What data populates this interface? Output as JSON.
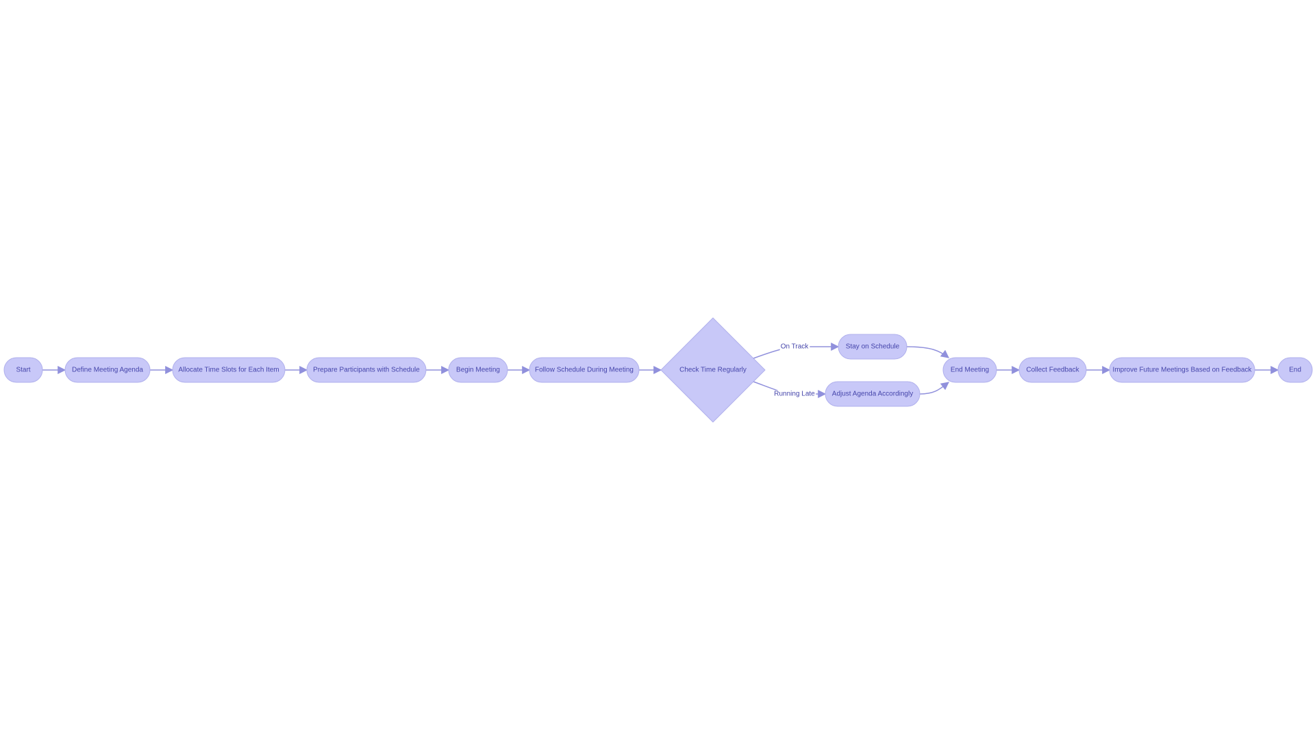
{
  "diagram": {
    "type": "flowchart",
    "direction": "left-to-right",
    "colors": {
      "node_fill": "#c8c8f8",
      "node_stroke": "#b0b0ec",
      "text": "#4444aa",
      "edge": "#9090dc",
      "background": "#ffffff"
    },
    "nodes": [
      {
        "id": "start",
        "label": "Start",
        "shape": "stadium"
      },
      {
        "id": "define",
        "label": "Define Meeting Agenda",
        "shape": "stadium"
      },
      {
        "id": "allocate",
        "label": "Allocate Time Slots for Each Item",
        "shape": "stadium"
      },
      {
        "id": "prepare",
        "label": "Prepare Participants with Schedule",
        "shape": "stadium"
      },
      {
        "id": "begin",
        "label": "Begin Meeting",
        "shape": "stadium"
      },
      {
        "id": "follow",
        "label": "Follow Schedule During Meeting",
        "shape": "stadium"
      },
      {
        "id": "check",
        "label": "Check Time Regularly",
        "shape": "diamond"
      },
      {
        "id": "stay",
        "label": "Stay on Schedule",
        "shape": "stadium"
      },
      {
        "id": "adjust",
        "label": "Adjust Agenda Accordingly",
        "shape": "stadium"
      },
      {
        "id": "endmeeting",
        "label": "End Meeting",
        "shape": "stadium"
      },
      {
        "id": "collect",
        "label": "Collect Feedback",
        "shape": "stadium"
      },
      {
        "id": "improve",
        "label": "Improve Future Meetings Based on Feedback",
        "shape": "stadium"
      },
      {
        "id": "end",
        "label": "End",
        "shape": "stadium"
      }
    ],
    "edges": [
      {
        "from": "start",
        "to": "define",
        "label": ""
      },
      {
        "from": "define",
        "to": "allocate",
        "label": ""
      },
      {
        "from": "allocate",
        "to": "prepare",
        "label": ""
      },
      {
        "from": "prepare",
        "to": "begin",
        "label": ""
      },
      {
        "from": "begin",
        "to": "follow",
        "label": ""
      },
      {
        "from": "follow",
        "to": "check",
        "label": ""
      },
      {
        "from": "check",
        "to": "stay",
        "label": "On Track"
      },
      {
        "from": "check",
        "to": "adjust",
        "label": "Running Late"
      },
      {
        "from": "stay",
        "to": "endmeeting",
        "label": ""
      },
      {
        "from": "adjust",
        "to": "endmeeting",
        "label": ""
      },
      {
        "from": "endmeeting",
        "to": "collect",
        "label": ""
      },
      {
        "from": "collect",
        "to": "improve",
        "label": ""
      },
      {
        "from": "improve",
        "to": "end",
        "label": ""
      }
    ]
  }
}
